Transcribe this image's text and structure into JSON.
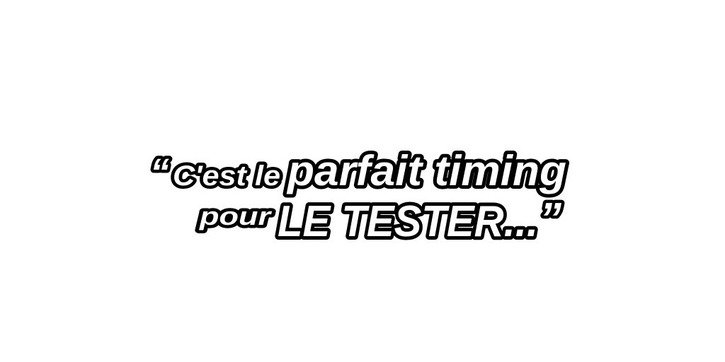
{
  "quote": {
    "open_mark": "“",
    "line1_small": "C'est le",
    "line1_big": "parfait timing",
    "line2_small": "pour",
    "line2_big": "LE TESTER...",
    "close_mark": "”"
  },
  "colors": {
    "background": "#ffffff",
    "text_fill": "#ffffff",
    "text_outline": "#000000"
  }
}
